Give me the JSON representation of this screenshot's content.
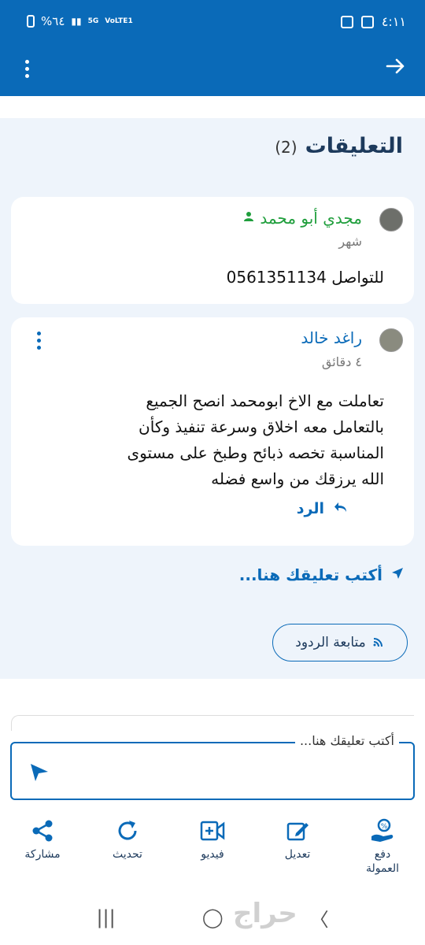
{
  "status_bar": {
    "time": "٤:١١",
    "battery": "%٦٤",
    "network_labels": [
      "5G",
      "VoLTE1"
    ]
  },
  "app_bar": {
    "back_icon": "arrow-right-icon",
    "menu_icon": "more-vertical-icon"
  },
  "comments_section": {
    "title": "التعليقات",
    "count": "(2)"
  },
  "comments": [
    {
      "author": "مجدي أبو محمد",
      "time": "شهر",
      "text": "للتواصل  0561351134",
      "verified": true
    },
    {
      "author": "راغد خالد",
      "time": "٤ دقائق",
      "text_lines": [
        "تعاملت مع الاخ ابومحمد انصح الجميع",
        "بالتعامل معه اخلاق وسرعة تنفيذ وكأن",
        "المناسبة تخصه    ذبائح وطبخ على مستوى",
        "الله يرزقك من واسع فضله"
      ],
      "reply_label": "الرد"
    }
  ],
  "write_comment_link": "أكتب تعليقك هنا...",
  "follow_button": "متابعة الردود",
  "comment_input": {
    "legend": "أكتب تعليقك هنا..."
  },
  "bottom_nav": [
    {
      "label": "دفع",
      "label2": "العمولة",
      "icon": "commission-icon"
    },
    {
      "label": "تعديل",
      "icon": "edit-icon"
    },
    {
      "label": "فيديو",
      "icon": "video-icon"
    },
    {
      "label": "تحديث",
      "icon": "refresh-icon"
    },
    {
      "label": "مشاركة",
      "icon": "share-icon"
    }
  ],
  "watermark": "حراج",
  "colors": {
    "primary": "#0a6ab8",
    "background": "#eef4fb",
    "verified_green": "#1f9e3c"
  }
}
